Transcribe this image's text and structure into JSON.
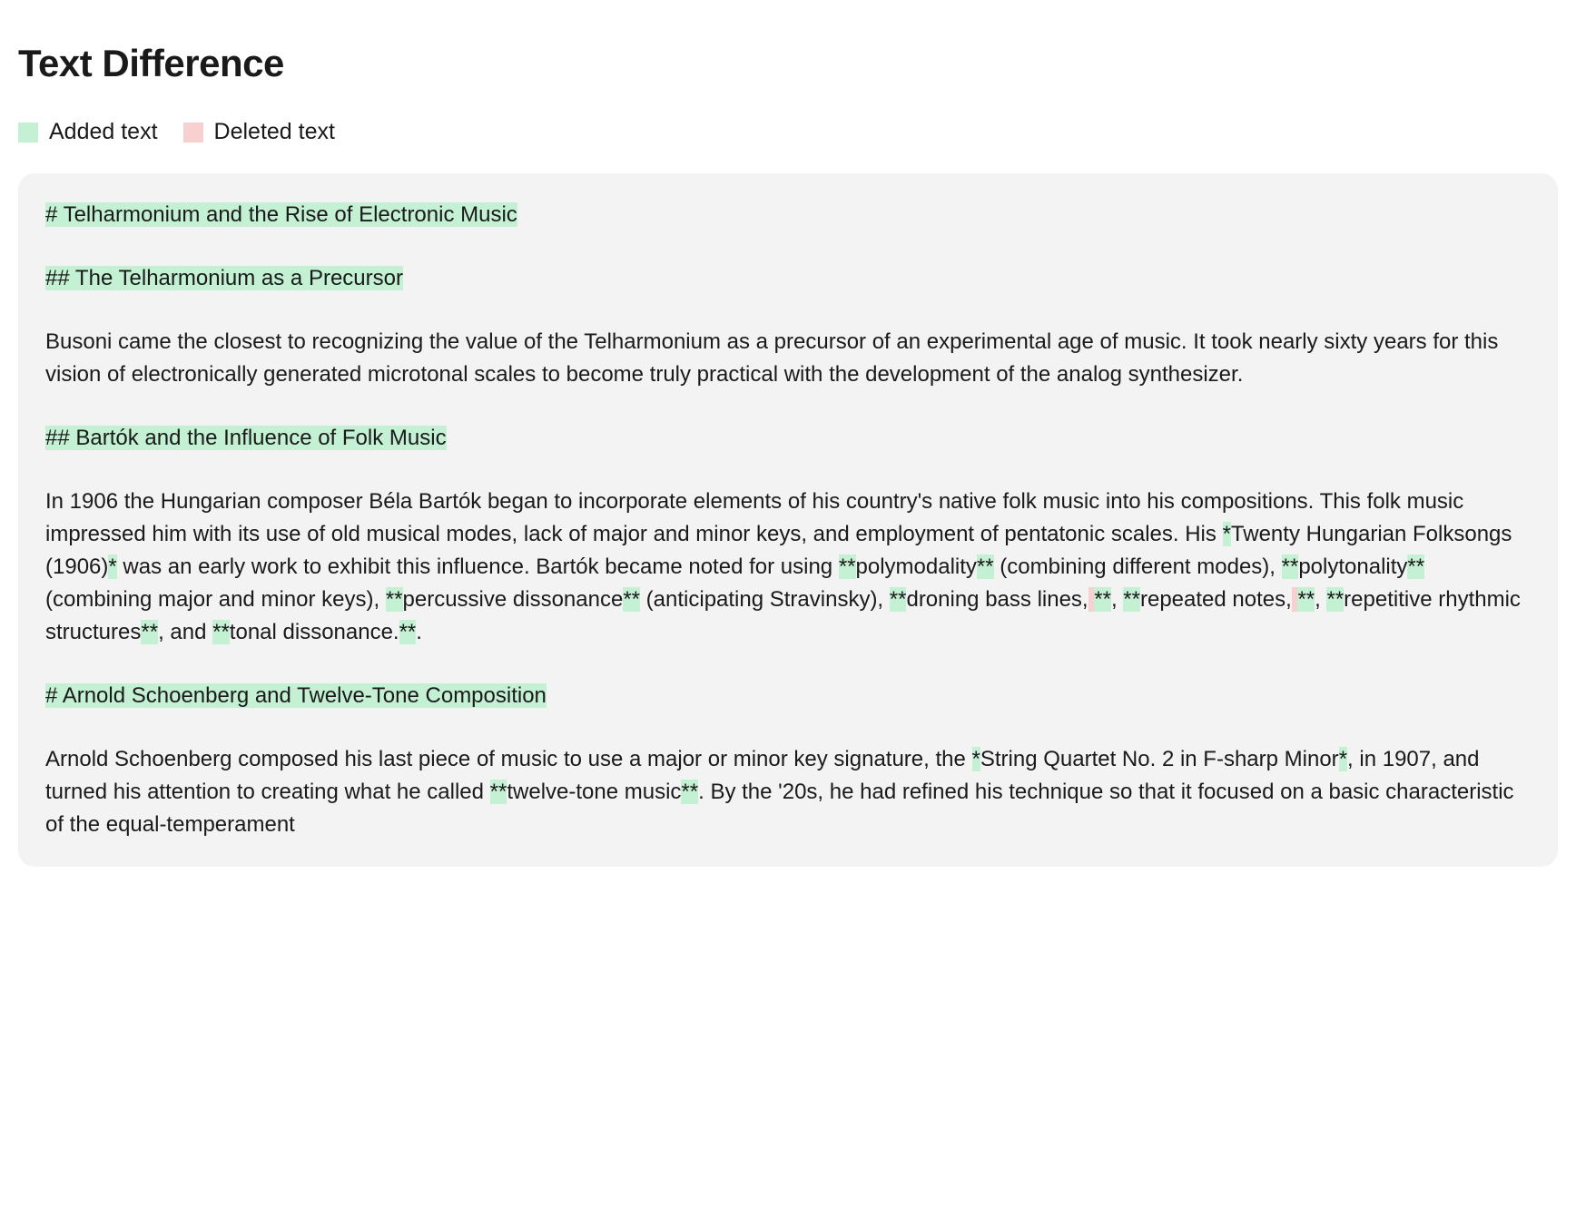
{
  "title": "Text Difference",
  "legend": {
    "added": "Added text",
    "deleted": "Deleted text"
  },
  "diff": {
    "lines": [
      [
        {
          "t": "added",
          "v": "# Telharmonium and the Rise of Electronic Music"
        }
      ],
      [
        {
          "t": "added",
          "v": "## The Telharmonium as a Precursor"
        }
      ],
      [
        {
          "t": "same",
          "v": "Busoni came the closest to recognizing the value of the Telharmonium as a precursor of an experimental age of music. It took nearly sixty years for this vision of electronically generated microtonal scales to become truly practical with the development of the analog synthesizer."
        }
      ],
      [
        {
          "t": "added",
          "v": "## Bartók and the Influence of Folk Music"
        }
      ],
      [
        {
          "t": "same",
          "v": "In 1906 the Hungarian composer Béla Bartók began to incorporate elements of his country's native folk music into his compositions. This folk music impressed him with its use of old musical modes, lack of major and minor keys, and employment of pentatonic scales. His "
        },
        {
          "t": "added",
          "v": "*"
        },
        {
          "t": "same",
          "v": "Twenty Hungarian Folksongs (1906)"
        },
        {
          "t": "added",
          "v": "*"
        },
        {
          "t": "same",
          "v": " was an early work to exhibit this influence. Bartók became noted for using "
        },
        {
          "t": "added",
          "v": "**"
        },
        {
          "t": "same",
          "v": "polymodality"
        },
        {
          "t": "added",
          "v": "**"
        },
        {
          "t": "same",
          "v": " (combining different modes), "
        },
        {
          "t": "added",
          "v": "**"
        },
        {
          "t": "same",
          "v": "polytonality"
        },
        {
          "t": "added",
          "v": "**"
        },
        {
          "t": "same",
          "v": " (combining major and minor keys), "
        },
        {
          "t": "added",
          "v": "**"
        },
        {
          "t": "same",
          "v": "percussive dissonance"
        },
        {
          "t": "added",
          "v": "**"
        },
        {
          "t": "same",
          "v": " (anticipating Stravinsky), "
        },
        {
          "t": "added",
          "v": "**"
        },
        {
          "t": "same",
          "v": "droning bass lines,"
        },
        {
          "t": "deleted",
          "v": " "
        },
        {
          "t": "added",
          "v": "**"
        },
        {
          "t": "same",
          "v": ", "
        },
        {
          "t": "added",
          "v": "**"
        },
        {
          "t": "same",
          "v": "repeated notes,"
        },
        {
          "t": "deleted",
          "v": " "
        },
        {
          "t": "added",
          "v": "**"
        },
        {
          "t": "same",
          "v": ", "
        },
        {
          "t": "added",
          "v": "**"
        },
        {
          "t": "same",
          "v": "repetitive rhythmic structures"
        },
        {
          "t": "added",
          "v": "**"
        },
        {
          "t": "same",
          "v": ", and "
        },
        {
          "t": "added",
          "v": "**"
        },
        {
          "t": "same",
          "v": "tonal dissonance."
        },
        {
          "t": "added",
          "v": "**"
        },
        {
          "t": "same",
          "v": "."
        }
      ],
      [
        {
          "t": "added",
          "v": "# Arnold Schoenberg and Twelve-Tone Composition"
        }
      ],
      [
        {
          "t": "same",
          "v": "Arnold Schoenberg composed his last piece of music to use a major or minor key signature, the "
        },
        {
          "t": "added",
          "v": "*"
        },
        {
          "t": "same",
          "v": "String Quartet No. 2 in F-sharp Minor"
        },
        {
          "t": "added",
          "v": "*"
        },
        {
          "t": "same",
          "v": ", in 1907, and turned his attention to creating what he called "
        },
        {
          "t": "added",
          "v": "**"
        },
        {
          "t": "same",
          "v": "twelve-tone music"
        },
        {
          "t": "added",
          "v": "**"
        },
        {
          "t": "same",
          "v": ". By the '20s, he had refined his technique so that it focused on a basic characteristic of the equal-temperament "
        }
      ]
    ]
  }
}
